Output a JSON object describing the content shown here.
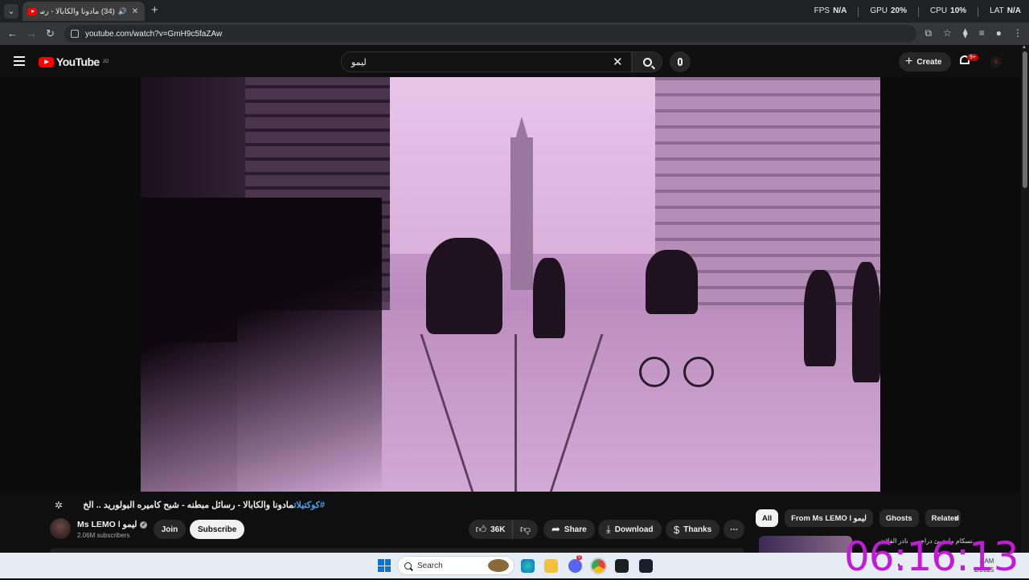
{
  "browser": {
    "tab_title": "(34) مادونا والكابالا - رسائل ...",
    "url": "youtube.com/watch?v=GmH9c5faZAw",
    "stats": {
      "fps_label": "FPS",
      "fps_value": "N/A",
      "gpu_label": "GPU",
      "gpu_value": "20%",
      "cpu_label": "CPU",
      "cpu_value": "10%",
      "lat_label": "LAT",
      "lat_value": "N/A"
    }
  },
  "youtube": {
    "logo_text": "YouTube",
    "logo_country": "JO",
    "search_value": "ليمو",
    "create_label": "Create",
    "notif_badge": "9+",
    "avatar_letter": "s"
  },
  "video": {
    "title_hashtag": "#كوكتيلات",
    "title_text": "مادونا والكابالا - رسائل مبطنه - شبح كاميره البولوريد .. الخ",
    "channel_name": "Ms LEMO l ليمو",
    "subscribers": "2.06M subscribers",
    "join_label": "Join",
    "subscribe_label": "Subscribe",
    "like_count": "36K",
    "share_label": "Share",
    "download_label": "Download",
    "thanks_label": "Thanks",
    "more_label": "⋯"
  },
  "chips": [
    "All",
    "From Ms LEMO l ليمو",
    "Ghosts",
    "Related"
  ],
  "sidebar_suggestion": "نسكام ما شيئ دراجه ... نادر الفلانة",
  "overlay_clock": "06:16:13",
  "taskbar": {
    "search_placeholder": "Search",
    "tray_time": "3 AM",
    "tray_date": "2/2025",
    "discord_badge": "9"
  }
}
